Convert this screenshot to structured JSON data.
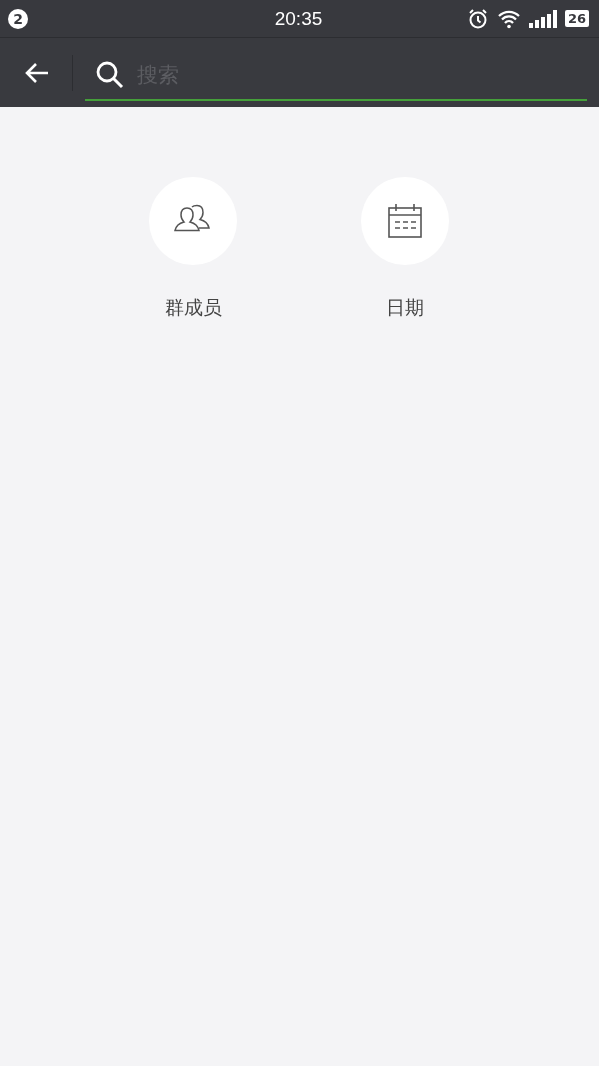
{
  "status_bar": {
    "notification_count": "2",
    "time": "20:35",
    "battery": "26"
  },
  "search": {
    "placeholder": "搜索"
  },
  "options": [
    {
      "kind": "members",
      "label": "群成员"
    },
    {
      "kind": "date",
      "label": "日期"
    }
  ]
}
